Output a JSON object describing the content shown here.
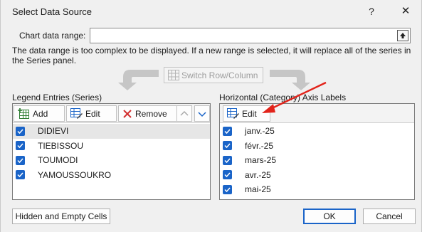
{
  "window": {
    "title": "Select Data Source",
    "help_glyph": "?",
    "close_glyph": "✕"
  },
  "range": {
    "label": "Chart data range:",
    "value": "",
    "collapse_icon": "collapse-dialog-icon"
  },
  "info": {
    "text": "The data range is too complex to be displayed. If a new range is selected, it will replace all of the series in the Series panel."
  },
  "switch": {
    "label": "Switch Row/Column",
    "enabled": false
  },
  "series_panel": {
    "label": "Legend Entries (Series)",
    "add_label": "Add",
    "edit_label": "Edit",
    "remove_label": "Remove",
    "items": [
      {
        "label": "DIDIEVI",
        "checked": true,
        "selected": true
      },
      {
        "label": "TIEBISSOU",
        "checked": true,
        "selected": false
      },
      {
        "label": "TOUMODI",
        "checked": true,
        "selected": false
      },
      {
        "label": "YAMOUSSOUKRO",
        "checked": true,
        "selected": false
      }
    ]
  },
  "category_panel": {
    "label": "Horizontal (Category) Axis Labels",
    "edit_label": "Edit",
    "items": [
      {
        "label": "janv.-25",
        "checked": true
      },
      {
        "label": "févr.-25",
        "checked": true
      },
      {
        "label": "mars-25",
        "checked": true
      },
      {
        "label": "avr.-25",
        "checked": true
      },
      {
        "label": "mai-25",
        "checked": true
      }
    ]
  },
  "footer": {
    "hidden_cells_label": "Hidden and Empty Cells",
    "ok_label": "OK",
    "cancel_label": "Cancel"
  },
  "colors": {
    "accent": "#1a64c8",
    "annotation_arrow": "#e2231a",
    "dialog_bg": "#f0f0f0",
    "selected_row": "#e6e6e6"
  }
}
